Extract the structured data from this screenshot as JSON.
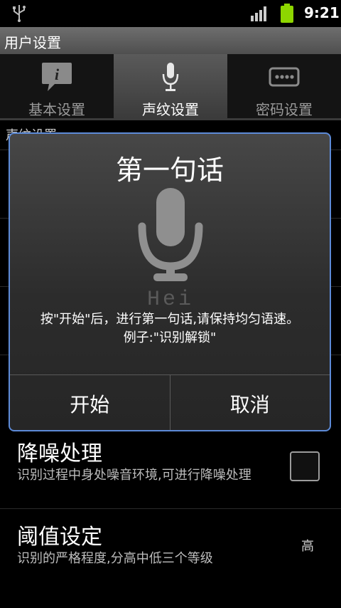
{
  "status_bar": {
    "time": "9:21",
    "icons": [
      "usb-icon",
      "signal-icon",
      "battery-icon"
    ]
  },
  "title_bar": {
    "title": "用户设置"
  },
  "tabs": [
    {
      "label": "基本设置",
      "icon": "info-bubble-icon",
      "selected": false
    },
    {
      "label": "声纹设置",
      "icon": "microphone-icon",
      "selected": true
    },
    {
      "label": "密码设置",
      "icon": "password-icon",
      "selected": false
    }
  ],
  "list": {
    "header": "声纹设置",
    "rows": [
      {
        "title": "降噪处理",
        "summary": "识别过程中身处噪音环境,可进行降噪处理",
        "control": "checkbox",
        "checked": false
      },
      {
        "title": "阈值设定",
        "summary": "识别的严格程度,分高中低三个等级",
        "value": "高"
      }
    ]
  },
  "dialog": {
    "title": "第一句话",
    "watermark": "Hei",
    "message_line1": "按\"开始\"后，进行第一句话,请保持均匀语速。",
    "message_line2": "例子:\"识别解锁\"",
    "buttons": {
      "start": "开始",
      "cancel": "取消"
    }
  },
  "colors": {
    "dialog_border": "#5d8bd8",
    "battery": "#8ed600"
  }
}
